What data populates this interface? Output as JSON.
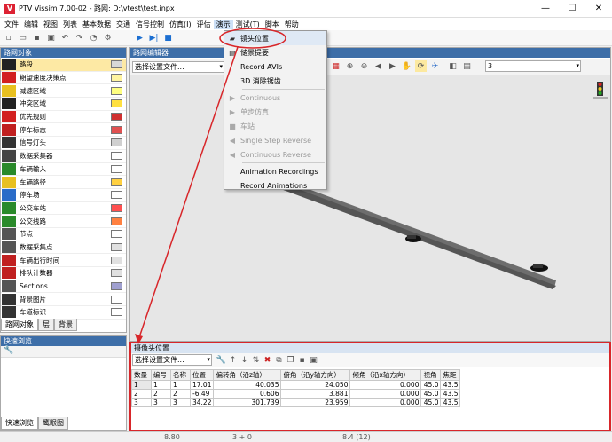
{
  "window": {
    "title": "PTV Vissim 7.00-02 - 路网: D:\\vtest\\test.inpx",
    "app_icon": "vissim-logo-icon",
    "controls": [
      "minimize-icon",
      "maximize-icon",
      "close-icon"
    ]
  },
  "menubar": {
    "items": [
      "文件",
      "编辑",
      "视图",
      "列表",
      "基本数据",
      "交通",
      "信号控制",
      "仿真(I)",
      "评估",
      "演示",
      "测试(T)",
      "脚本",
      "帮助"
    ]
  },
  "presentation_menu": {
    "items": [
      {
        "label": "镜头位置",
        "icon": "camera-icon",
        "enabled": true,
        "highlighted": true
      },
      {
        "label": "储景提要",
        "icon": "storyboard-icon",
        "enabled": true
      },
      {
        "label": "Record AVIs",
        "icon": "",
        "enabled": true
      },
      {
        "label": "3D 消除锯齿",
        "icon": "",
        "enabled": true
      },
      {
        "label": "Continuous",
        "icon": "play-icon",
        "enabled": false
      },
      {
        "label": "单步仿真",
        "icon": "step-icon",
        "enabled": false
      },
      {
        "label": "车站",
        "icon": "stop-icon",
        "enabled": false
      },
      {
        "label": "Single Step Reverse",
        "icon": "step-reverse-icon",
        "enabled": false
      },
      {
        "label": "Continuous Reverse",
        "icon": "reverse-icon",
        "enabled": false
      },
      {
        "label": "Animation Recordings",
        "icon": "",
        "enabled": true
      },
      {
        "label": "Record Animations",
        "icon": "",
        "enabled": true
      }
    ]
  },
  "network_objects": {
    "title": "路网对象",
    "items": [
      {
        "label": "路段",
        "selected": true,
        "icon_color": "#222222",
        "swatch": "#d8d8d8"
      },
      {
        "label": "期望速度决策点",
        "icon_color": "#d22020",
        "swatch": "#fff4a0"
      },
      {
        "label": "减速区域",
        "icon_color": "#e8c020",
        "swatch": "#ffff80"
      },
      {
        "label": "冲突区域",
        "icon_color": "#222222",
        "swatch": "#ffe040"
      },
      {
        "label": "优先规则",
        "icon_color": "#d22020",
        "swatch": "#d03030"
      },
      {
        "label": "停车标志",
        "icon_color": "#c02020",
        "swatch": "#e05050"
      },
      {
        "label": "信号灯头",
        "icon_color": "#333333",
        "swatch": "#d0d0d0"
      },
      {
        "label": "数据采集器",
        "icon_color": "#444444",
        "swatch": "#ffffff"
      },
      {
        "label": "车辆输入",
        "icon_color": "#2a8a2a",
        "swatch": "#ffffff"
      },
      {
        "label": "车辆路径",
        "icon_color": "#e8c020",
        "swatch": "#ffd040"
      },
      {
        "label": "停车场",
        "icon_color": "#2a6cc8",
        "swatch": "#ffffff"
      },
      {
        "label": "公交车站",
        "icon_color": "#2a8a2a",
        "swatch": "#ff5050"
      },
      {
        "label": "公交线路",
        "icon_color": "#2a8a2a",
        "swatch": "#ff8040"
      },
      {
        "label": "节点",
        "icon_color": "#555555",
        "swatch": "#ffffff"
      },
      {
        "label": "数据采集点",
        "icon_color": "#555555",
        "swatch": "#e0e0e0"
      },
      {
        "label": "车辆出行时间",
        "icon_color": "#c02020",
        "swatch": "#e0e0e0"
      },
      {
        "label": "排队计数器",
        "icon_color": "#c02020",
        "swatch": "#e0e0e0"
      },
      {
        "label": "Sections",
        "icon_color": "#555555",
        "swatch": "#a0a0d0"
      },
      {
        "label": "背景图片",
        "icon_color": "#333333",
        "swatch": "#ffffff"
      },
      {
        "label": "车道标识",
        "icon_color": "#333333",
        "swatch": "#ffffff"
      }
    ],
    "tabs": [
      "路网对象",
      "层",
      "背景"
    ]
  },
  "quick_view": {
    "title": "快速浏览",
    "tabs": [
      "快速浏览",
      "鹰眼图"
    ]
  },
  "network_editor": {
    "title": "路网编辑器",
    "layout_select": "选择设置文件...",
    "zoom_value": "3"
  },
  "camera_panel": {
    "title": "摄像头位置",
    "layout_select": "选择设置文件...",
    "columns": [
      "数量",
      "编号",
      "名称",
      "位置",
      "偏转角（沿z轴）",
      "俯角（沿y轴方向）",
      "倾角（沿x轴方向）",
      "视角",
      "焦距"
    ],
    "rows": [
      {
        "count": "1",
        "no": "1",
        "name": "1",
        "pos": "17.01",
        "yaw": "40.035",
        "pitch": "24.050",
        "roll": "0.000",
        "fov": "45.0",
        "focal": "43.5"
      },
      {
        "count": "2",
        "no": "2",
        "name": "2",
        "pos": "-6.49",
        "yaw": "0.606",
        "pitch": "3.881",
        "roll": "0.000",
        "fov": "45.0",
        "focal": "43.5"
      },
      {
        "count": "3",
        "no": "3",
        "name": "3",
        "pos": "34.22",
        "yaw": "301.739",
        "pitch": "23.959",
        "roll": "0.000",
        "fov": "45.0",
        "focal": "43.5"
      }
    ]
  },
  "statusbar": {
    "zoom": "8.80",
    "objects": "3 + 0",
    "coords": "8.4 (12)"
  },
  "annotation": {
    "color": "#d8262a"
  }
}
